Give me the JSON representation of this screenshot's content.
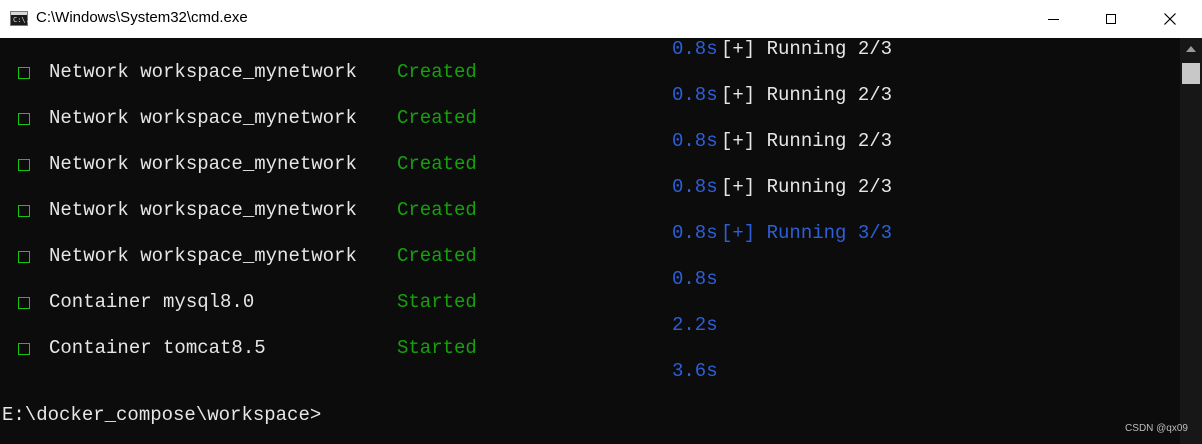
{
  "window": {
    "title": "C:\\Windows\\System32\\cmd.exe",
    "icon_text": "C:\\."
  },
  "colors": {
    "background": "#0c0c0c",
    "foreground": "#e6e6e6",
    "status_green": "#16a10c",
    "timing_blue": "#2c5fd8"
  },
  "console": {
    "lines": [
      {
        "timing": "0.8s",
        "progress": "[+] Running 2/3"
      },
      {
        "object": "Network workspace_mynetwork",
        "status": "Created",
        "timing": "0.8s",
        "progress": "[+] Running 2/3"
      },
      {
        "object": "Network workspace_mynetwork",
        "status": "Created",
        "timing": "0.8s",
        "progress": "[+] Running 2/3"
      },
      {
        "object": "Network workspace_mynetwork",
        "status": "Created",
        "timing": "0.8s",
        "progress": "[+] Running 2/3"
      },
      {
        "object": "Network workspace_mynetwork",
        "status": "Created",
        "timing": "0.8s",
        "progress": "[+] Running 3/3"
      },
      {
        "object": "Network workspace_mynetwork",
        "status": "Created",
        "timing": "0.8s"
      },
      {
        "object": "Container mysql8.0",
        "status": "Started",
        "timing": "2.2s"
      },
      {
        "object": "Container tomcat8.5",
        "status": "Started",
        "timing": "3.6s"
      }
    ],
    "prompt": "E:\\docker_compose\\workspace>"
  },
  "watermark": "CSDN @qx09"
}
